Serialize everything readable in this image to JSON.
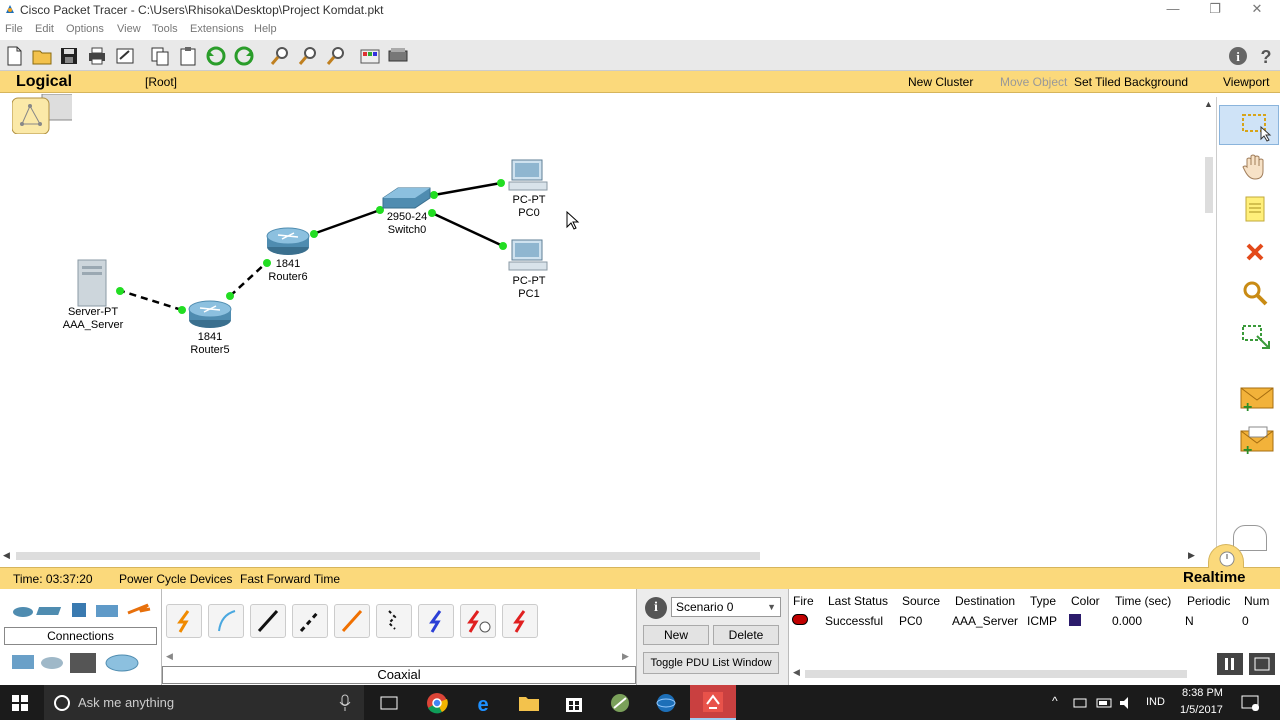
{
  "window": {
    "title": "Cisco Packet Tracer - C:\\Users\\Rhisoka\\Desktop\\Project Komdat.pkt",
    "minimize": "—",
    "restore": "❐",
    "close": "✕"
  },
  "menu": [
    "File",
    "Edit",
    "Options",
    "View",
    "Tools",
    "Extensions",
    "Help"
  ],
  "logical_bar": {
    "mode": "Logical",
    "path": "[Root]",
    "new_cluster": "New Cluster",
    "move_object": "Move Object",
    "set_tiled_background": "Set Tiled Background",
    "viewport": "Viewport"
  },
  "devices": [
    {
      "model": "Server-PT",
      "name": "AAA_Server"
    },
    {
      "model": "1841",
      "name": "Router5"
    },
    {
      "model": "1841",
      "name": "Router6"
    },
    {
      "model": "2950-24",
      "name": "Switch0"
    },
    {
      "model": "PC-PT",
      "name": "PC0"
    },
    {
      "model": "PC-PT",
      "name": "PC1"
    }
  ],
  "status_bar": {
    "time": "Time: 03:37:20",
    "power_cycle": "Power Cycle Devices",
    "fast_forward": "Fast Forward Time",
    "mode": "Realtime"
  },
  "bottom": {
    "category_label": "Connections",
    "connection_type": "Coaxial"
  },
  "scenario": {
    "selected": "Scenario 0",
    "new_label": "New",
    "delete_label": "Delete",
    "toggle_label": "Toggle PDU List Window"
  },
  "pdu_table": {
    "headers": [
      "Fire",
      "Last Status",
      "Source",
      "Destination",
      "Type",
      "Color",
      "Time (sec)",
      "Periodic",
      "Num"
    ],
    "rows": [
      {
        "fire": "",
        "last_status": "Successful",
        "source": "PC0",
        "destination": "AAA_Server",
        "type": "ICMP",
        "color": "#2b1b6b",
        "time": "0.000",
        "periodic": "N",
        "num": "0"
      }
    ]
  },
  "taskbar": {
    "search_placeholder": "Ask me anything",
    "language": "IND",
    "time": "8:38 PM",
    "date": "1/5/2017"
  },
  "colors": {
    "accent_bar": "#fbd97b",
    "link_green": "#22dd22",
    "pdu_color": "#2b1b6b"
  }
}
